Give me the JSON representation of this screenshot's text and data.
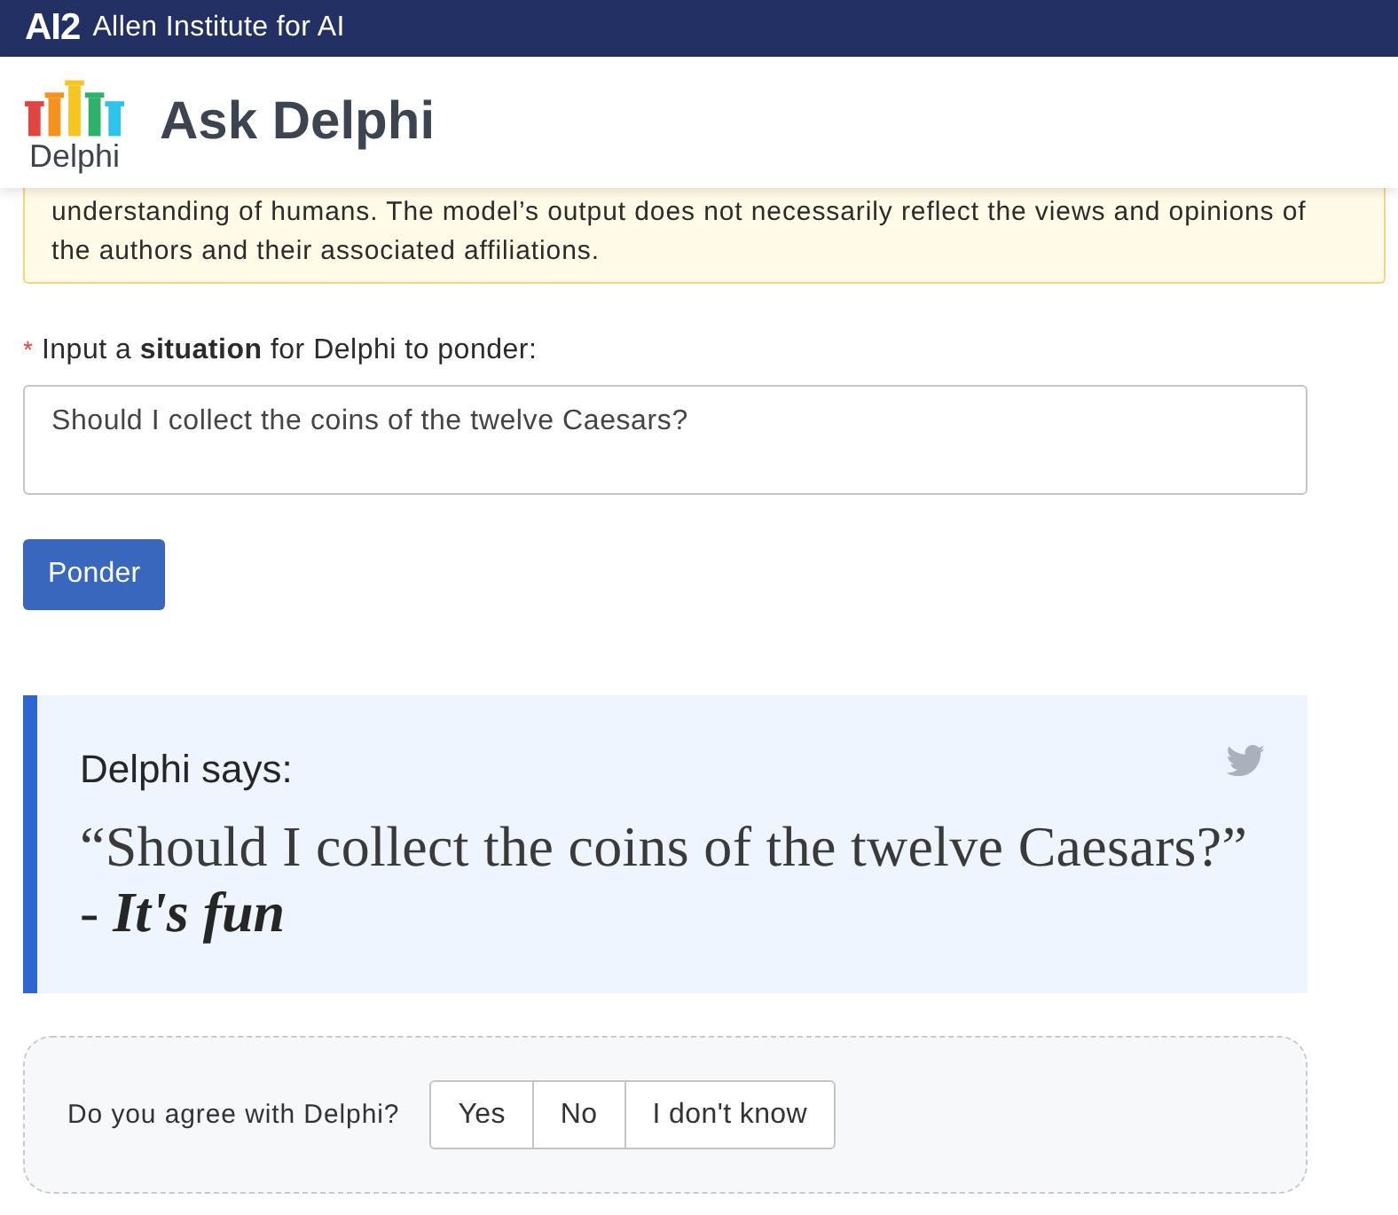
{
  "top_bar": {
    "logo": "AI2",
    "title": "Allen Institute for AI"
  },
  "header": {
    "logo_text": "Delphi",
    "title": "Ask Delphi"
  },
  "notice": {
    "text": "understanding of humans. The model’s output does not necessarily reflect the views and opinions of the authors and their associated affiliations."
  },
  "form": {
    "required_mark": "*",
    "label": "Input a **situation** for Delphi to ponder:",
    "input": {
      "value": "Should I collect the coins of the twelve Caesars?"
    },
    "button": "Ponder"
  },
  "result": {
    "heading": "Delphi says:",
    "quote": "“Should I collect the coins of the twelve Caesars?”",
    "answer": "- **It's fun**"
  },
  "feedback": {
    "question": "Do you agree with Delphi?",
    "options": [
      {
        "label": "Yes",
        "selected": false
      },
      {
        "label": "No",
        "selected": false
      },
      {
        "label": "I don't know",
        "selected": false
      }
    ]
  }
}
